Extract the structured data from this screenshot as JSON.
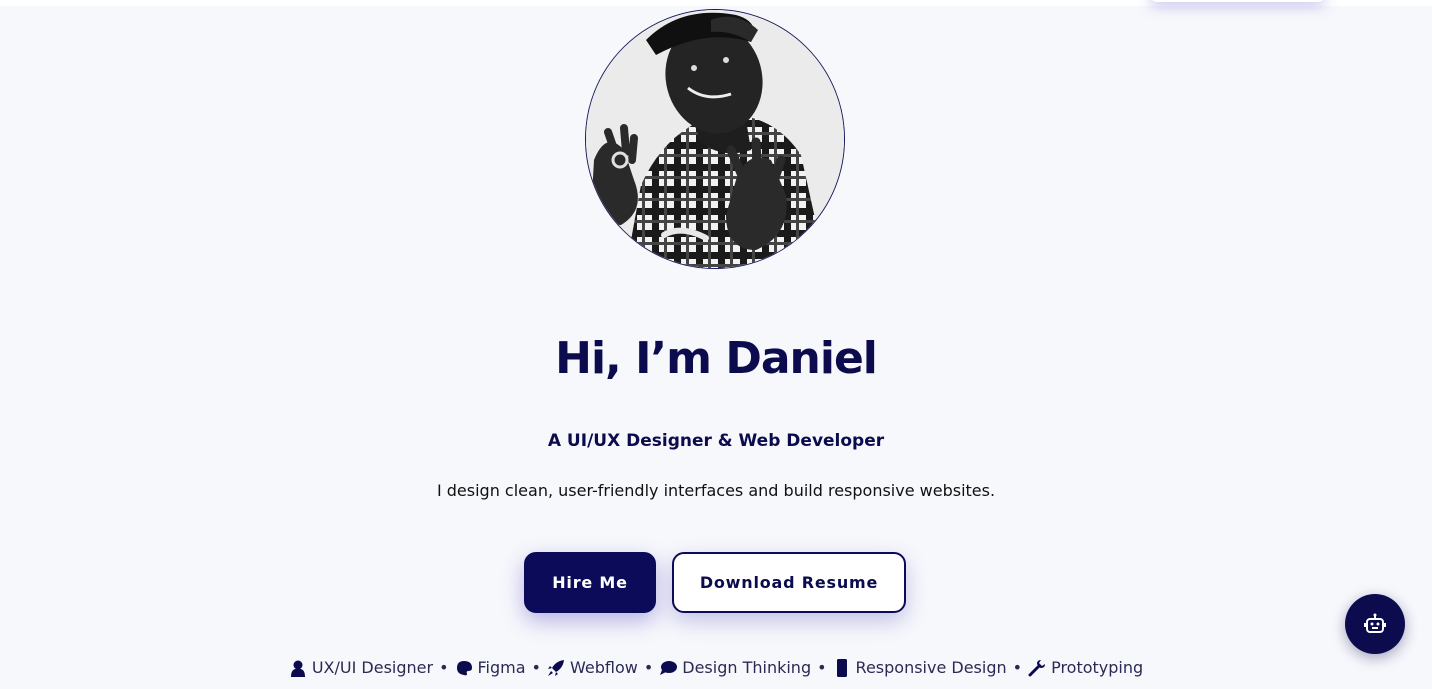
{
  "hero": {
    "avatar_alt": "Daniel profile photo",
    "title": "Hi, I’m Daniel",
    "subtitle": "A UI/UX Designer & Web Developer",
    "description": "I design clean, user-friendly interfaces and build responsive websites."
  },
  "buttons": {
    "hire_label": "Hire Me",
    "resume_label": "Download Resume"
  },
  "skills": [
    {
      "icon": "person-icon",
      "label": "UX/UI Designer"
    },
    {
      "icon": "palette-icon",
      "label": "Figma"
    },
    {
      "icon": "rocket-icon",
      "label": "Webflow"
    },
    {
      "icon": "speech-bubble-icon",
      "label": "Design Thinking"
    },
    {
      "icon": "phone-icon",
      "label": "Responsive Design"
    },
    {
      "icon": "wrench-icon",
      "label": "Prototyping"
    }
  ],
  "skills_separator": "•",
  "chatbot": {
    "icon": "robot-icon"
  },
  "colors": {
    "primary": "#0b0b5a",
    "background": "#f7f8fc",
    "text": "#111111"
  }
}
